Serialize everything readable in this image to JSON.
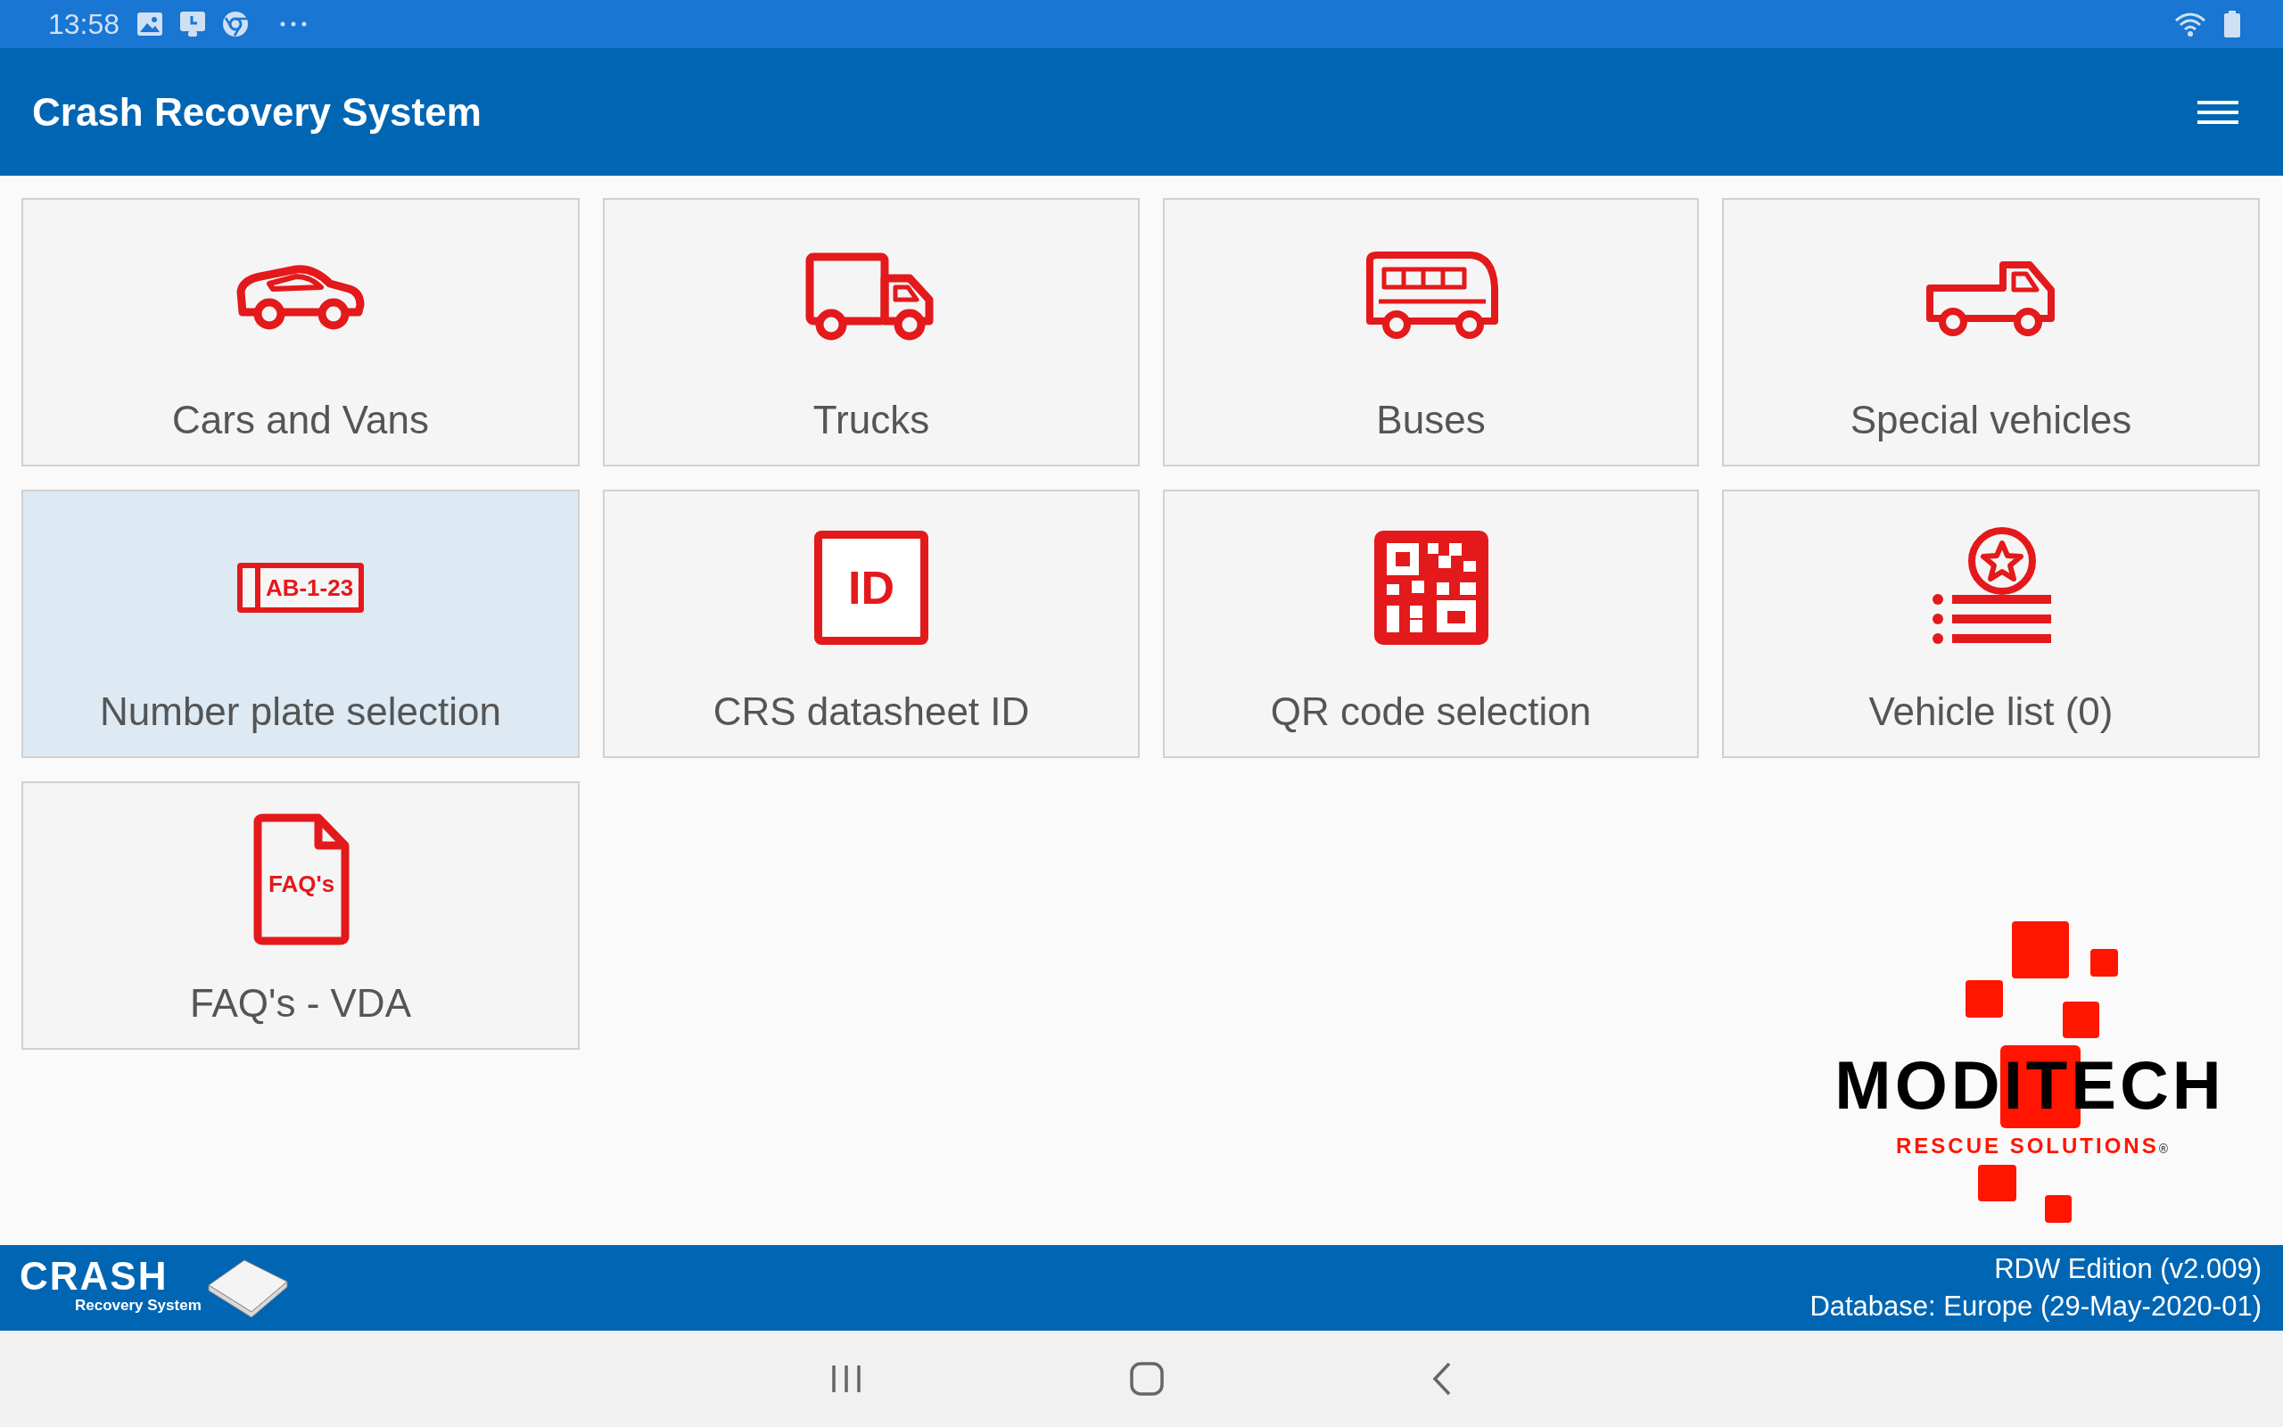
{
  "status_bar": {
    "time": "13:58"
  },
  "app_bar": {
    "title": "Crash Recovery System"
  },
  "tiles": [
    {
      "label": "Cars and Vans",
      "kind": "car",
      "selected": false
    },
    {
      "label": "Trucks",
      "kind": "truck",
      "selected": false
    },
    {
      "label": "Buses",
      "kind": "bus",
      "selected": false
    },
    {
      "label": "Special vehicles",
      "kind": "pickup",
      "selected": false
    },
    {
      "label": "Number plate selection",
      "kind": "plate",
      "icon_text": "AB-1-23",
      "selected": true
    },
    {
      "label": "CRS datasheet ID",
      "kind": "id",
      "icon_text": "ID",
      "selected": false
    },
    {
      "label": "QR code selection",
      "kind": "qr",
      "selected": false
    },
    {
      "label": "Vehicle list (0)",
      "kind": "list",
      "selected": false
    },
    {
      "label": "FAQ's - VDA",
      "kind": "faq",
      "icon_text": "FAQ's",
      "selected": false
    }
  ],
  "brand_logo": {
    "name": "MODITECH",
    "tagline": "RESCUE SOLUTIONS",
    "mark": "®"
  },
  "footer": {
    "logo_title": "CRASH",
    "logo_subtitle": "Recovery System",
    "edition": "RDW Edition (v2.009)",
    "database": "Database: Europe (29-May-2020-01)"
  }
}
